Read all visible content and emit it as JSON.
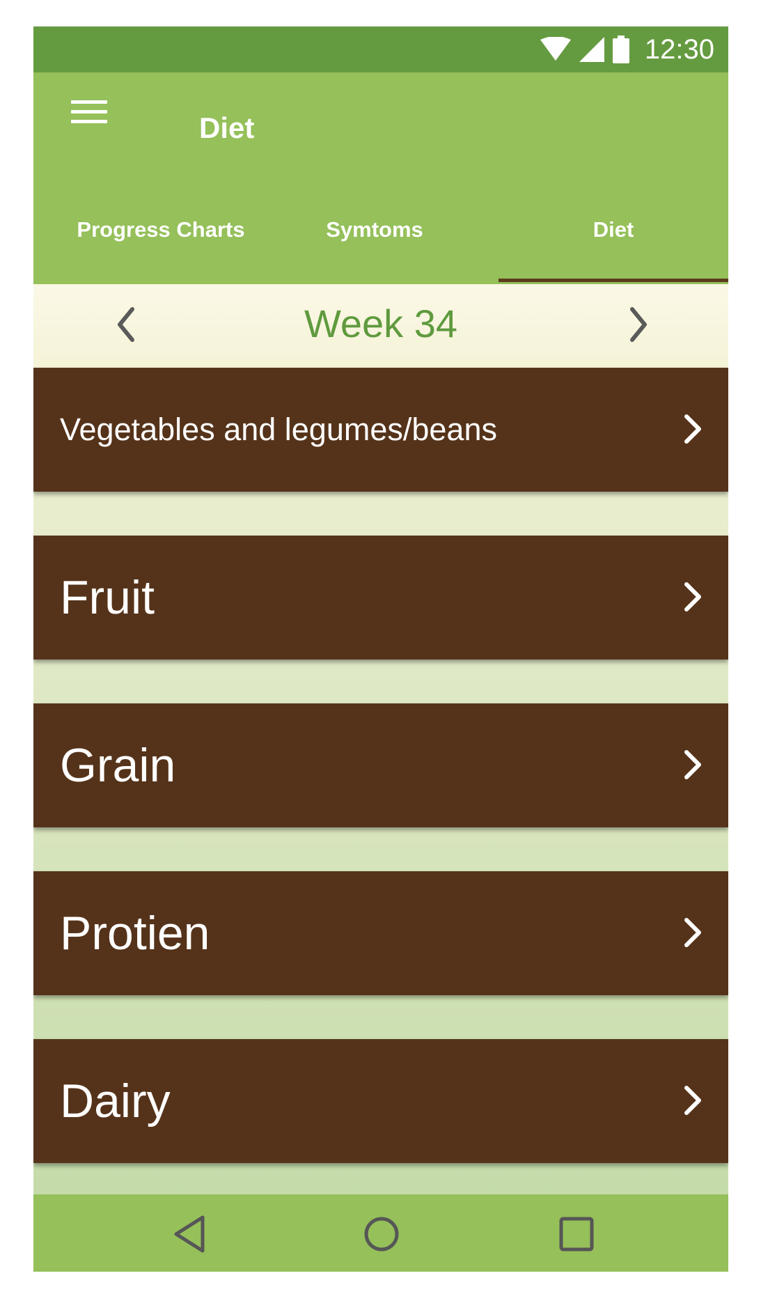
{
  "status_bar": {
    "time": "12:30",
    "icons": [
      "wifi-icon",
      "cell-signal-icon",
      "battery-icon"
    ]
  },
  "app_bar": {
    "title": "Diet",
    "menu_icon": "menu-icon"
  },
  "tabs": [
    {
      "label": "Progress Charts",
      "selected": false
    },
    {
      "label": "Symtoms",
      "selected": false
    },
    {
      "label": "Diet",
      "selected": true
    }
  ],
  "week_nav": {
    "label": "Week 34",
    "prev_icon": "chevron-left-icon",
    "next_icon": "chevron-right-icon"
  },
  "categories": [
    {
      "label": "Vegetables and legumes/beans"
    },
    {
      "label": "Fruit"
    },
    {
      "label": "Grain"
    },
    {
      "label": "Protien"
    },
    {
      "label": "Dairy"
    }
  ],
  "nav_bar": {
    "icons": [
      "back-icon",
      "home-icon",
      "recents-icon"
    ]
  },
  "colors": {
    "status_bar": "#659b40",
    "app_bar": "#95c05a",
    "card": "#55331a",
    "week_text": "#5f9a3e",
    "tab_indicator": "#5b3b1c"
  }
}
